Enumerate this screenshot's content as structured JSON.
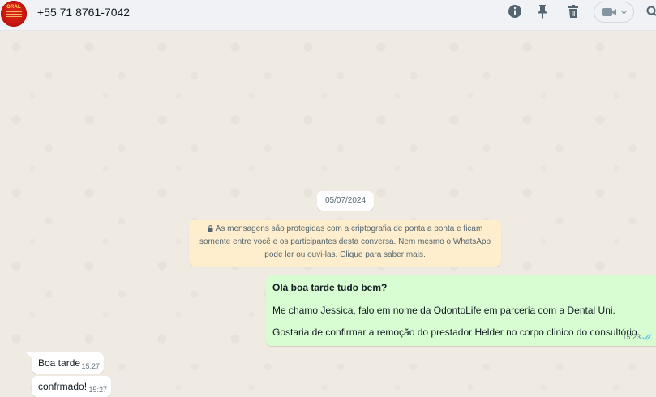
{
  "header": {
    "contact_name": "+55 71 8761-7042",
    "avatar_text": "ORAL",
    "icons": [
      "info-icon",
      "pin-icon",
      "trash-icon",
      "video-call-icon",
      "chevron-down-icon",
      "search-icon"
    ]
  },
  "chat": {
    "date_label": "05/07/2024",
    "encryption_notice": {
      "line1": "As mensagens são protegidas com a criptografia de ponta a ponta e ficam",
      "line2": "somente entre você e os participantes desta conversa. Nem mesmo o WhatsApp",
      "line3": "pode ler ou ouvi-las. Clique para saber mais."
    },
    "outgoing": {
      "line1": "Olá boa tarde tudo bem?",
      "line2": "Me chamo Jessica, falo em nome da OdontoLife em parceria com a Dental Uni.",
      "line3": "Gostaria de confirmar a remoção do prestador Helder no corpo clinico do consultório.",
      "time": "15:23"
    },
    "incoming": [
      {
        "text": "Boa tarde",
        "time": "15:27"
      },
      {
        "text": "confrmado!",
        "time": "15:27"
      }
    ]
  },
  "colors": {
    "header_bg": "#f0f2f5",
    "chat_bg": "#efeae2",
    "outgoing_bubble": "#d9fdd3",
    "incoming_bubble": "#ffffff",
    "notice_bg": "#ffeecd",
    "read_ticks": "#53bdeb"
  }
}
